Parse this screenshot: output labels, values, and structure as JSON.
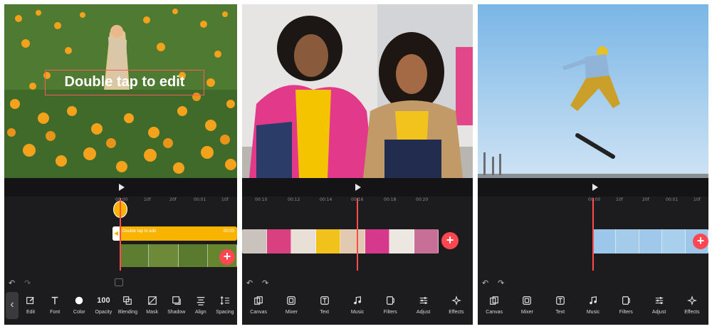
{
  "colors": {
    "accent": "#f8b400",
    "add": "#ff4752",
    "playhead": "#ff4d4d",
    "bg": "#1c1c1e"
  },
  "panel1": {
    "overlay_text": "Double tap to edit",
    "clip_label": "Double tap to edit",
    "clip_time": "00:03",
    "ruler": [
      "00:00",
      "10f",
      "20f",
      "00:01",
      "10f"
    ],
    "tools": [
      {
        "label": "Edit",
        "icon": "edit-icon"
      },
      {
        "label": "Font",
        "icon": "font-icon"
      },
      {
        "label": "Color",
        "icon": "color-icon"
      },
      {
        "label": "Opacity",
        "icon": "opacity-value",
        "value": "100"
      },
      {
        "label": "Blending",
        "icon": "blending-icon"
      },
      {
        "label": "Mask",
        "icon": "mask-icon"
      },
      {
        "label": "Shadow",
        "icon": "shadow-icon"
      },
      {
        "label": "Align",
        "icon": "align-icon"
      },
      {
        "label": "Spacing",
        "icon": "spacing-icon"
      }
    ]
  },
  "panel2": {
    "ruler": [
      "00:10",
      "00:12",
      "00:14",
      "00:16",
      "00:18",
      "00:20"
    ],
    "tools": [
      {
        "label": "Canvas",
        "icon": "canvas-icon"
      },
      {
        "label": "Mixer",
        "icon": "mixer-icon"
      },
      {
        "label": "Text",
        "icon": "text-icon"
      },
      {
        "label": "Music",
        "icon": "music-icon"
      },
      {
        "label": "Filters",
        "icon": "filters-icon"
      },
      {
        "label": "Adjust",
        "icon": "adjust-icon"
      },
      {
        "label": "Effects",
        "icon": "effects-icon"
      }
    ]
  },
  "panel3": {
    "ruler": [
      "00:00",
      "10f",
      "20f",
      "00:01",
      "10f"
    ],
    "tools": [
      {
        "label": "Canvas",
        "icon": "canvas-icon"
      },
      {
        "label": "Mixer",
        "icon": "mixer-icon"
      },
      {
        "label": "Text",
        "icon": "text-icon"
      },
      {
        "label": "Music",
        "icon": "music-icon"
      },
      {
        "label": "Filters",
        "icon": "filters-icon"
      },
      {
        "label": "Adjust",
        "icon": "adjust-icon"
      },
      {
        "label": "Effects",
        "icon": "effects-icon"
      }
    ]
  }
}
